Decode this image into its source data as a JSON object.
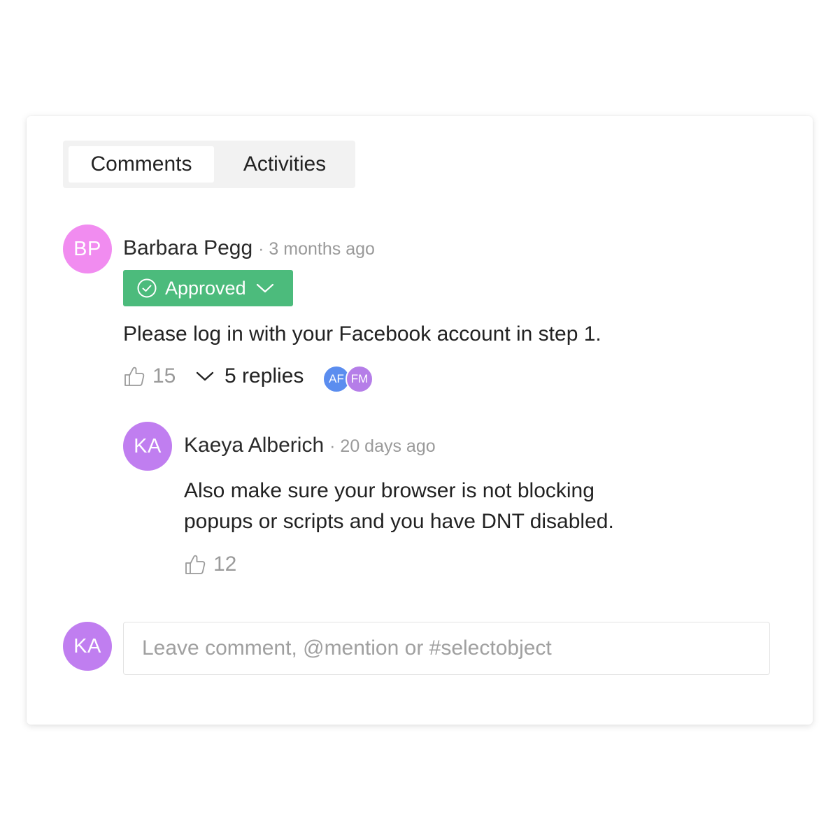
{
  "tabs": [
    {
      "label": "Comments",
      "active": true
    },
    {
      "label": "Activities",
      "active": false
    }
  ],
  "comment": {
    "avatar_initials": "BP",
    "avatar_color": "#f18cf0",
    "author": "Barbara Pegg",
    "time": "· 3 months ago",
    "status": {
      "label": "Approved",
      "color": "#4cbb7c"
    },
    "text": "Please log in with your Facebook account in step 1.",
    "likes": "15",
    "replies_label": "5 replies",
    "reply_avatars": [
      {
        "initials": "AF",
        "color": "#5b8def"
      },
      {
        "initials": "FM",
        "color": "#b57ee8"
      }
    ]
  },
  "reply": {
    "avatar_initials": "KA",
    "avatar_color": "#c07ef0",
    "author": "Kaeya Alberich",
    "time": "· 20 days ago",
    "text_line1": "Also make sure your browser is not blocking",
    "text_line2": "popups or scripts and you have DNT disabled.",
    "likes": "12"
  },
  "composer": {
    "avatar_initials": "KA",
    "avatar_color": "#c07ef0",
    "placeholder": "Leave comment, @mention or #selectobject"
  }
}
